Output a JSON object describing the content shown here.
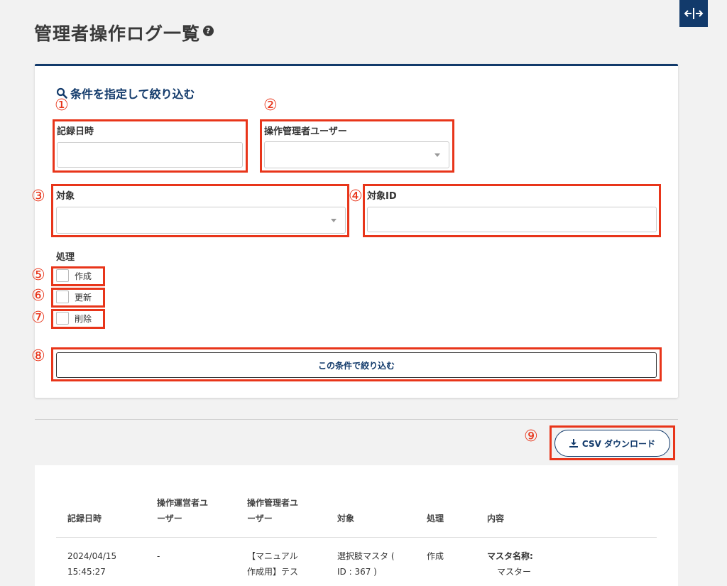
{
  "header": {
    "title": "管理者操作ログ一覧",
    "help_icon": "?"
  },
  "toggle": {
    "icon": "expand-horizontal-icon",
    "glyph": "←|→"
  },
  "filter": {
    "heading": "条件を指定して絞り込む",
    "fields": {
      "recorded_at": {
        "label": "記録日時",
        "value": "",
        "marker": "①"
      },
      "admin_user": {
        "label": "操作管理者ユーザー",
        "value": "",
        "marker": "②"
      },
      "target": {
        "label": "対象",
        "value": "",
        "marker": "③"
      },
      "target_id": {
        "label": "対象ID",
        "value": "",
        "marker": "④"
      }
    },
    "process": {
      "label": "処理",
      "options": [
        {
          "label": "作成",
          "checked": false,
          "marker": "⑤"
        },
        {
          "label": "更新",
          "checked": false,
          "marker": "⑥"
        },
        {
          "label": "削除",
          "checked": false,
          "marker": "⑦"
        }
      ]
    },
    "apply_button": {
      "label": "この条件で絞り込む",
      "marker": "⑧"
    }
  },
  "csv": {
    "label": "CSV ダウンロード",
    "marker": "⑨"
  },
  "table": {
    "columns": [
      "記録日時",
      "操作運営者ユ\nーザー",
      "操作管理者ユ\nーザー",
      "対象",
      "処理",
      "内容"
    ],
    "rows": [
      {
        "recorded_at": "2024/04/15\n15:45:27",
        "operator_user": "-",
        "admin_user": "【マニュアル\n作成用】テス",
        "target": "選択肢マスタ (\nID : 367 )",
        "process": "作成",
        "content_label": "マスタ名称:",
        "content_value": "マスター"
      }
    ]
  },
  "colors": {
    "accent": "#123a6b",
    "annotation": "#e8351a"
  }
}
